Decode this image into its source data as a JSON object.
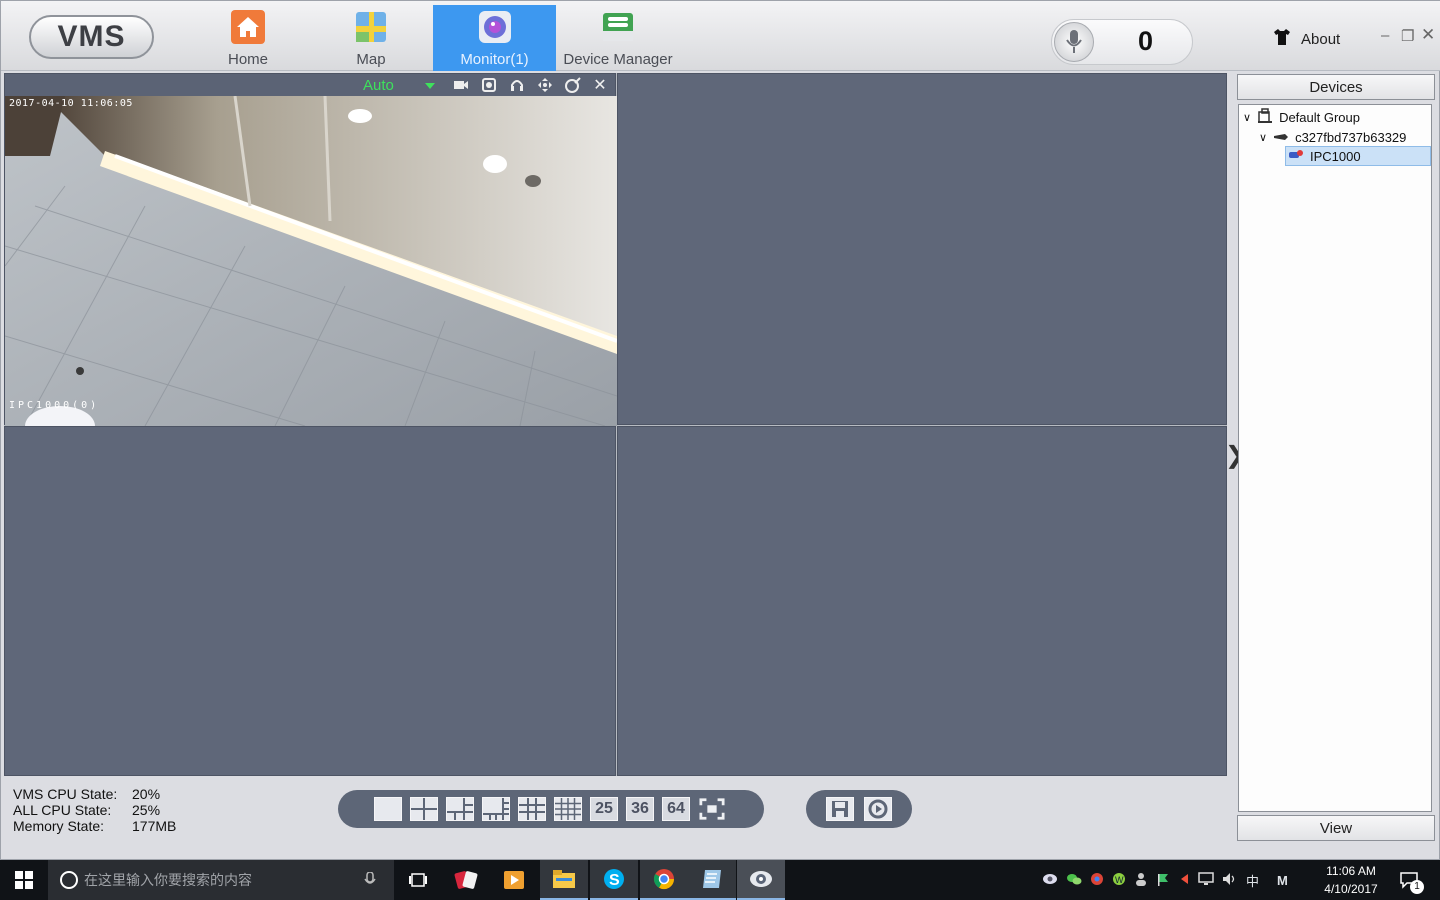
{
  "app": {
    "logo_text": "VMS"
  },
  "nav": {
    "home": "Home",
    "map": "Map",
    "monitor": "Monitor(1)",
    "device_manager": "Device Manager"
  },
  "header": {
    "counter_value": "0",
    "about_label": "About"
  },
  "video": {
    "stream_mode": "Auto",
    "timestamp": "2017-04-10 11:06:05",
    "camera_overlay": "IPC1000(0)"
  },
  "devices_panel": {
    "title": "Devices",
    "tree": [
      {
        "label": "Default Group"
      },
      {
        "label": "c327fbd737b63329"
      },
      {
        "label": "IPC1000"
      }
    ],
    "view_label": "View"
  },
  "status": {
    "vms_cpu_label": "VMS CPU State:",
    "vms_cpu_value": "20%",
    "all_cpu_label": "ALL CPU State:",
    "all_cpu_value": "25%",
    "memory_label": "Memory State:",
    "memory_value": "177MB"
  },
  "layout_bar": {
    "labels": [
      "25",
      "36",
      "64"
    ]
  },
  "taskbar": {
    "search_placeholder": "在这里输入你要搜索的内容",
    "ime": "中",
    "ime2": "M",
    "time": "11:06 AM",
    "date": "4/10/2017",
    "notification_count": "1"
  },
  "colors": {
    "accent": "#3d98f0",
    "cell_bg": "#5f6779",
    "auto_green": "#3ee15c"
  }
}
